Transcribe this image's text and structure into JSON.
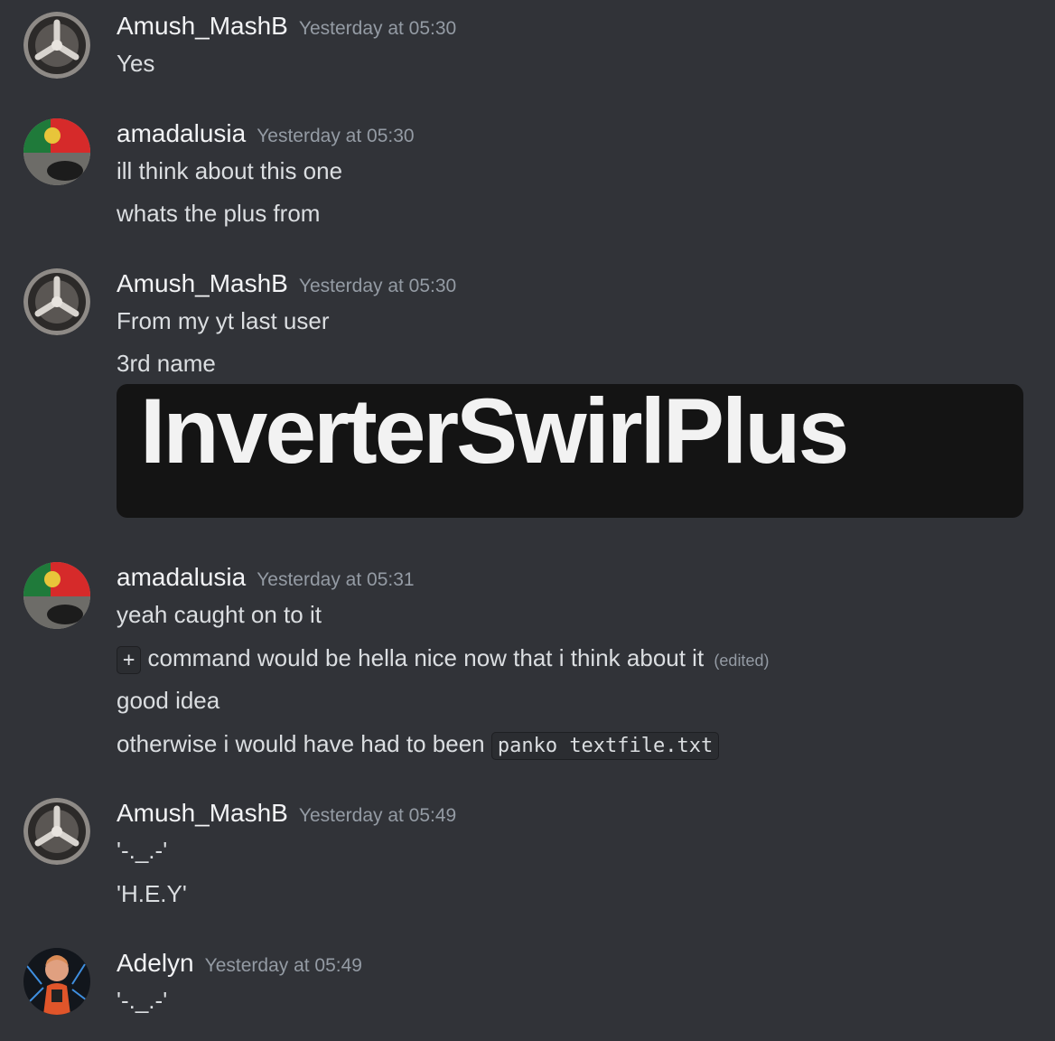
{
  "messages": [
    {
      "author": "Amush_MashB",
      "avatar_icon": "triskelion-avatar-icon",
      "timestamp": "Yesterday at 05:30",
      "lines": [
        "Yes"
      ]
    },
    {
      "author": "amadalusia",
      "avatar_icon": "portugal-flag-avatar-icon",
      "timestamp": "Yesterday at 05:30",
      "lines": [
        "ill think about this one",
        "whats the plus from"
      ]
    },
    {
      "author": "Amush_MashB",
      "avatar_icon": "triskelion-avatar-icon",
      "timestamp": "Yesterday at 05:30",
      "lines": [
        "From my yt last user",
        "3rd name"
      ],
      "attachment_text": "InverterSwirlPlus"
    },
    {
      "author": "amadalusia",
      "avatar_icon": "portugal-flag-avatar-icon",
      "timestamp": "Yesterday at 05:31",
      "lines": [
        "yeah caught on to it"
      ],
      "command_line": {
        "code": "+",
        "text": "command would be hella nice now that i think about it",
        "edited": "(edited)"
      },
      "lines_after": [
        "good idea"
      ],
      "code_line": {
        "text": "otherwise i would have had to been",
        "code": "panko textfile.txt"
      }
    },
    {
      "author": "Amush_MashB",
      "avatar_icon": "triskelion-avatar-icon",
      "timestamp": "Yesterday at 05:49",
      "lines": [
        "'-._.-'",
        "'H.E.Y'"
      ]
    },
    {
      "author": "Adelyn",
      "avatar_icon": "character-avatar-icon",
      "timestamp": "Yesterday at 05:49",
      "lines": [
        "'-._.-'"
      ]
    }
  ],
  "colors": {
    "background": "#313338",
    "username": "#f2f3f5",
    "timestamp": "#949ba4",
    "text": "#dbdee1"
  }
}
